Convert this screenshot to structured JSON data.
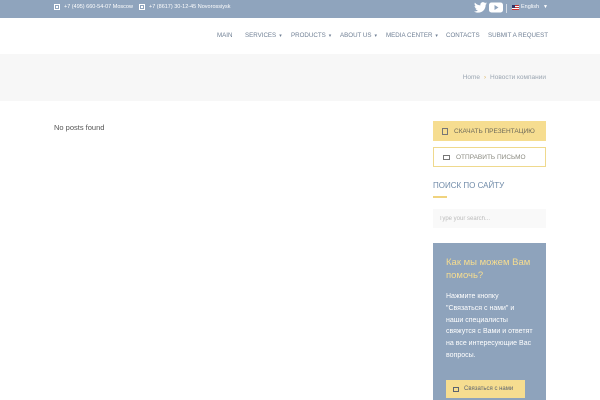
{
  "topbar": {
    "phone1": "+7 (495) 660-54-07 Moscow",
    "phone2": "+7 (8617) 30-12-45 Novorossiysk",
    "language": "English"
  },
  "nav": {
    "main": "Main",
    "services": "Services",
    "products": "Products",
    "about": "About Us",
    "media": "Media Center",
    "contacts": "Contacts",
    "submit": "Submit a Request"
  },
  "breadcrumb": {
    "home": "Home",
    "current": "Новости компании"
  },
  "content": {
    "empty_message": "No posts found"
  },
  "sidebar": {
    "presentation_label": "Скачать презентацию",
    "mail_label": "Отправить письмо",
    "search_title": "Поиск по сайту",
    "search_placeholder": "Type your search...",
    "help_title": "Как мы можем Вам помочь?",
    "help_text": "Нажмите кнопку \"Связаться с нами\" и наши специалисты свяжутся с Вами и ответят на все интересующие Вас вопросы.",
    "help_button": "Связаться с нами"
  },
  "colors": {
    "topbar": "#8fa4bd",
    "accent_yellow": "#f6dd90",
    "help_box": "#8ea3bc"
  },
  "icons": [
    "phone-icon",
    "twitter-icon",
    "youtube-icon",
    "flag-icon",
    "chevron-down-icon",
    "file-icon",
    "envelope-icon"
  ]
}
